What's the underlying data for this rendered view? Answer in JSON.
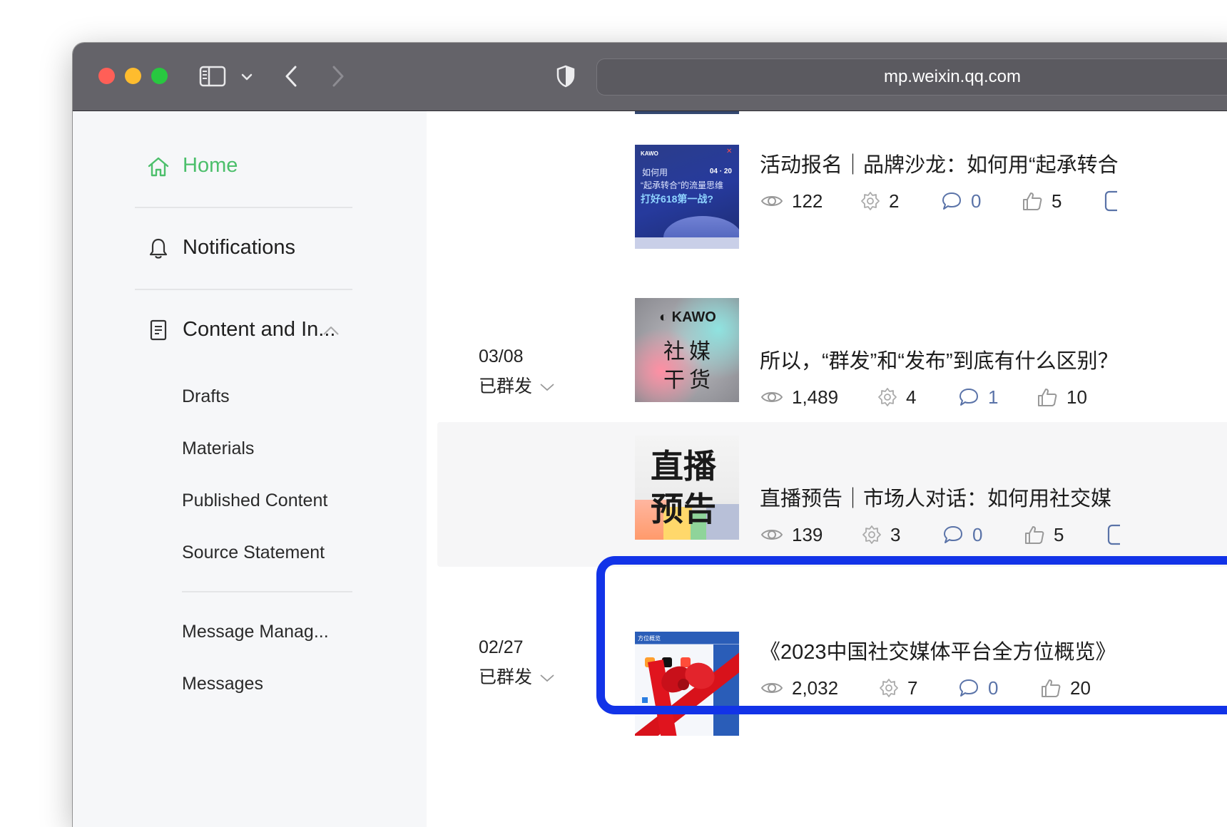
{
  "browser": {
    "url": "mp.weixin.qq.com"
  },
  "sidebar": {
    "home": "Home",
    "notifications": "Notifications",
    "content": "Content and In...",
    "sub_items": [
      "Drafts",
      "Materials",
      "Published Content",
      "Source Statement"
    ],
    "message_management": "Message Manag...",
    "messages": "Messages"
  },
  "articles": [
    {
      "date": "",
      "status": "",
      "title": "活动报名｜品牌沙龙：如何用“起承转合",
      "thumb": {
        "brand": "KAWO",
        "line1": "如何用",
        "line2": "“起承转合”的流量思维",
        "line3": "打好618第一战?",
        "date_label": "04 · 20"
      },
      "reads": "122",
      "shares": "2",
      "comments": "0",
      "likes": "5"
    },
    {
      "date": "03/08",
      "status": "已群发",
      "title": "所以，“群发”和“发布”到底有什么区别？",
      "thumb": {
        "brand": "KAWO",
        "line1": "社媒",
        "line2": "干货"
      },
      "reads": "1,489",
      "shares": "4",
      "comments": "1",
      "likes": "10"
    },
    {
      "date": "",
      "status": "",
      "title": "直播预告｜市场人对话：如何用社交媒",
      "thumb": {
        "line1": "直播",
        "line2": "预告"
      },
      "reads": "139",
      "shares": "3",
      "comments": "0",
      "likes": "5"
    },
    {
      "date": "02/27",
      "status": "已群发",
      "title": "《2023中国社交媒体平台全方位概览》",
      "thumb": {
        "label": "方位概览"
      },
      "reads": "2,032",
      "shares": "7",
      "comments": "0",
      "likes": "20"
    }
  ],
  "colors": {
    "accent_green": "#4cbf6b",
    "highlight_blue": "#1233e8",
    "comment_blue": "#5a73a8"
  }
}
